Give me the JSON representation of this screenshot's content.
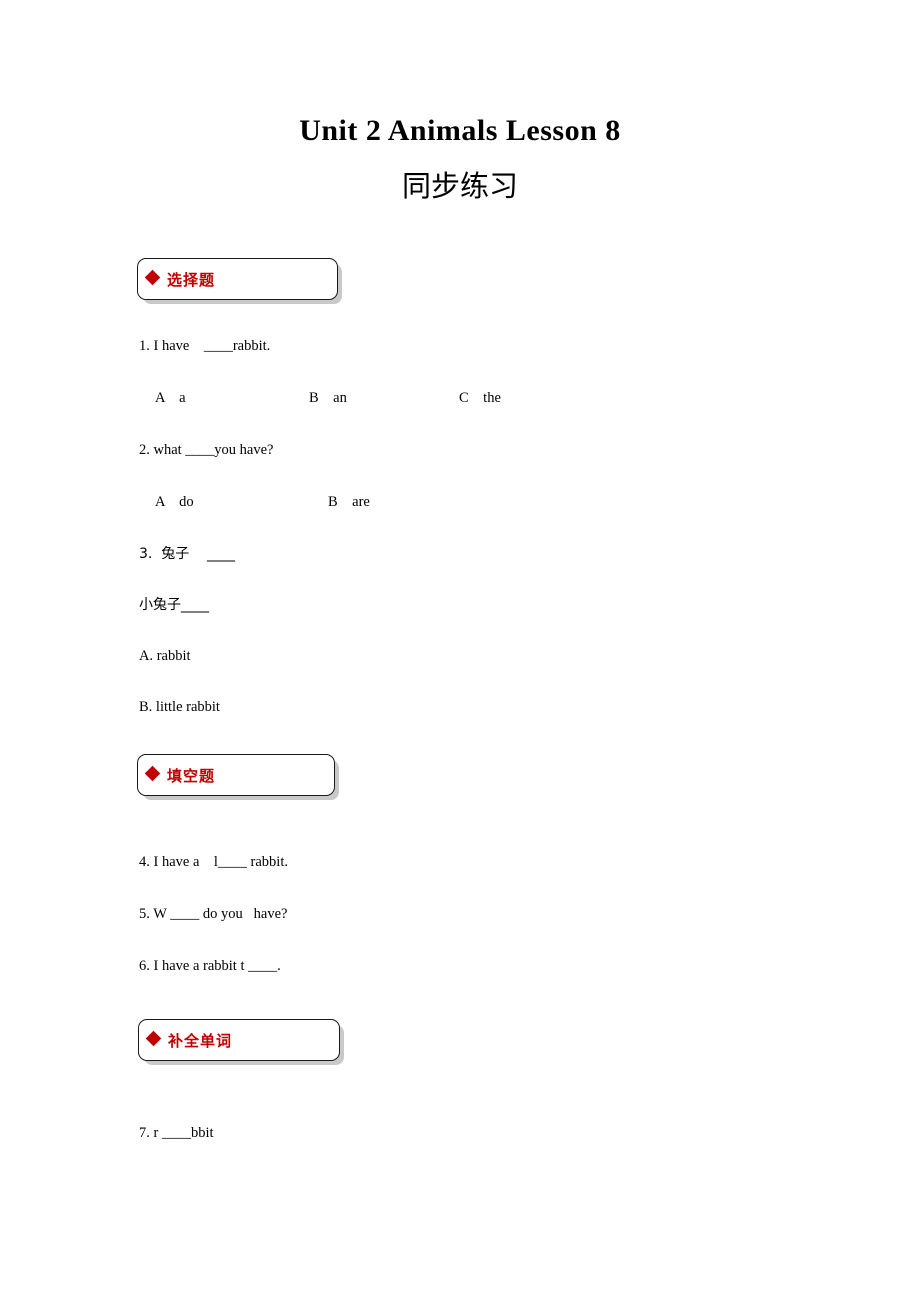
{
  "document": {
    "title": "Unit 2 Animals Lesson 8",
    "subtitle": "同步练习"
  },
  "accent_color": "#c00000",
  "sections": [
    {
      "icon": "red-diamond-bullet",
      "label": "选择题",
      "questions": [
        {
          "number": "1.",
          "text": "1. I have    ____rabbit.",
          "options": [
            {
              "letter": "A",
              "value": "a",
              "text": "A    a"
            },
            {
              "letter": "B",
              "value": "an",
              "text": "B    an"
            },
            {
              "letter": "C",
              "value": "the",
              "text": "C    the"
            }
          ]
        },
        {
          "number": "2.",
          "text": "2. what ____you have?",
          "options": [
            {
              "letter": "A",
              "value": "do",
              "text": "A    do"
            },
            {
              "letter": "B",
              "value": "are",
              "text": "B    are"
            }
          ]
        },
        {
          "number": "3.",
          "text": "3.  兔子    ____",
          "text2": "小兔子____",
          "options": [
            {
              "letter": "A",
              "value": "rabbit",
              "text": "A. rabbit"
            },
            {
              "letter": "B",
              "value": "little rabbit",
              "text": "B. little rabbit"
            }
          ]
        }
      ]
    },
    {
      "icon": "red-diamond-bullet",
      "label": "填空题",
      "questions": [
        {
          "number": "4.",
          "text": "4. I have a    l____ rabbit."
        },
        {
          "number": "5.",
          "text": "5. W ____ do you   have?"
        },
        {
          "number": "6.",
          "text": "6. I have a rabbit t ____."
        }
      ]
    },
    {
      "icon": "red-diamond-bullet",
      "label": "补全单词",
      "questions": [
        {
          "number": "7.",
          "text": "7. r ____bbit"
        }
      ]
    }
  ]
}
